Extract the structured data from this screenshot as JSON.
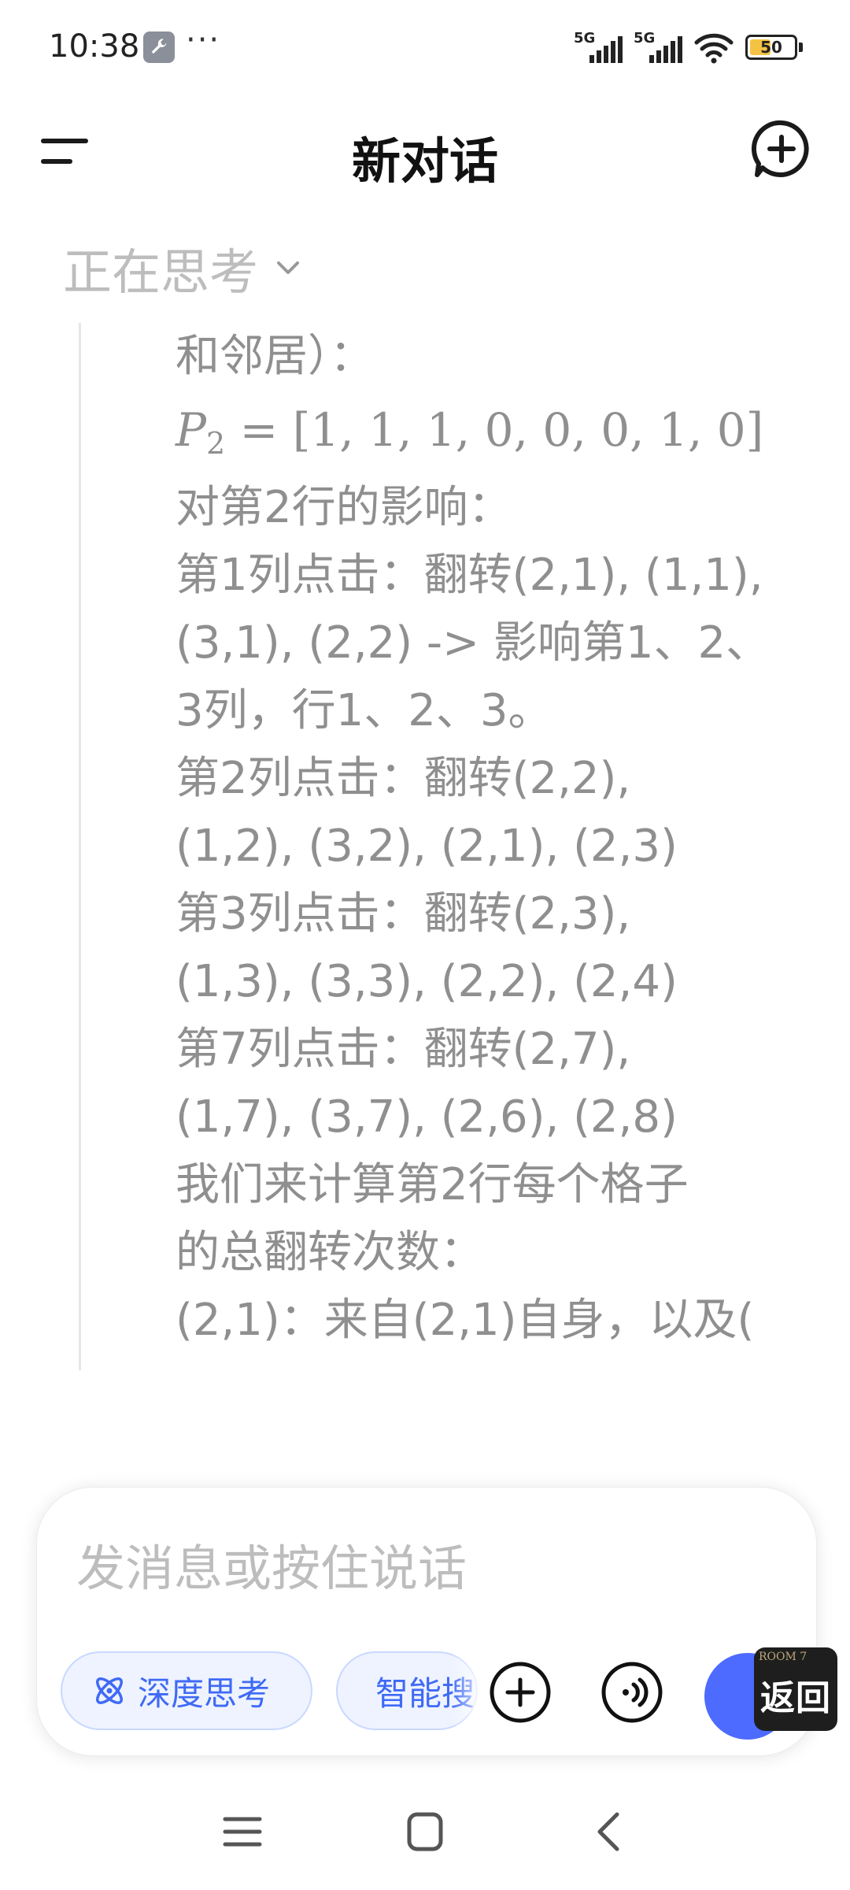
{
  "status_bar": {
    "time": "10:38",
    "overflow": "···",
    "signal1": "5G",
    "signal2": "5G",
    "battery": "50",
    "icons": [
      "wrench-icon",
      "signal-icon",
      "signal-icon",
      "wifi-icon",
      "battery-icon"
    ]
  },
  "header": {
    "title": "新对话",
    "icons": [
      "menu-icon",
      "new-chat-icon"
    ]
  },
  "thinking": {
    "label": "正在思考",
    "icon": "chevron-down-icon",
    "lines": [
      "和邻居）：",
      "对第2行的影响：",
      "第1列点击：翻转(2,1), (1,1),",
      "(3,1), (2,2) -> 影响第1、2、",
      "3列，行1、2、3。",
      "第2列点击：翻转(2,2),",
      "(1,2), (3,2), (2,1), (2,3)",
      "第3列点击：翻转(2,3),",
      "(1,3), (3,3), (2,2), (2,4)",
      "第7列点击：翻转(2,7),",
      "(1,7), (3,7), (2,6), (2,8)",
      "我们来计算第2行每个格子",
      "的总翻转次数：",
      "(2,1)：来自(2,1)自身，以及("
    ],
    "math": {
      "symbol": "P",
      "subscript": "2",
      "expression": "= [1, 1, 1, 0, 0, 0, 1, 0]"
    }
  },
  "input": {
    "placeholder": "发消息或按住说话",
    "chips": {
      "deep_think": "深度思考",
      "search": "智能搜索"
    },
    "icons": [
      "atom-icon",
      "globe-icon",
      "plus-icon",
      "voice-call-icon",
      "send-icon"
    ]
  },
  "floating": {
    "tag": "ROOM 7",
    "label": "返回"
  },
  "nav": {
    "icons": [
      "recent-apps-icon",
      "home-icon",
      "back-icon"
    ]
  },
  "colors": {
    "accent": "#4d6bfe",
    "chip_bg": "#eef3ff",
    "thinking_text": "#8f8f8f",
    "placeholder": "#bdbdbd"
  }
}
